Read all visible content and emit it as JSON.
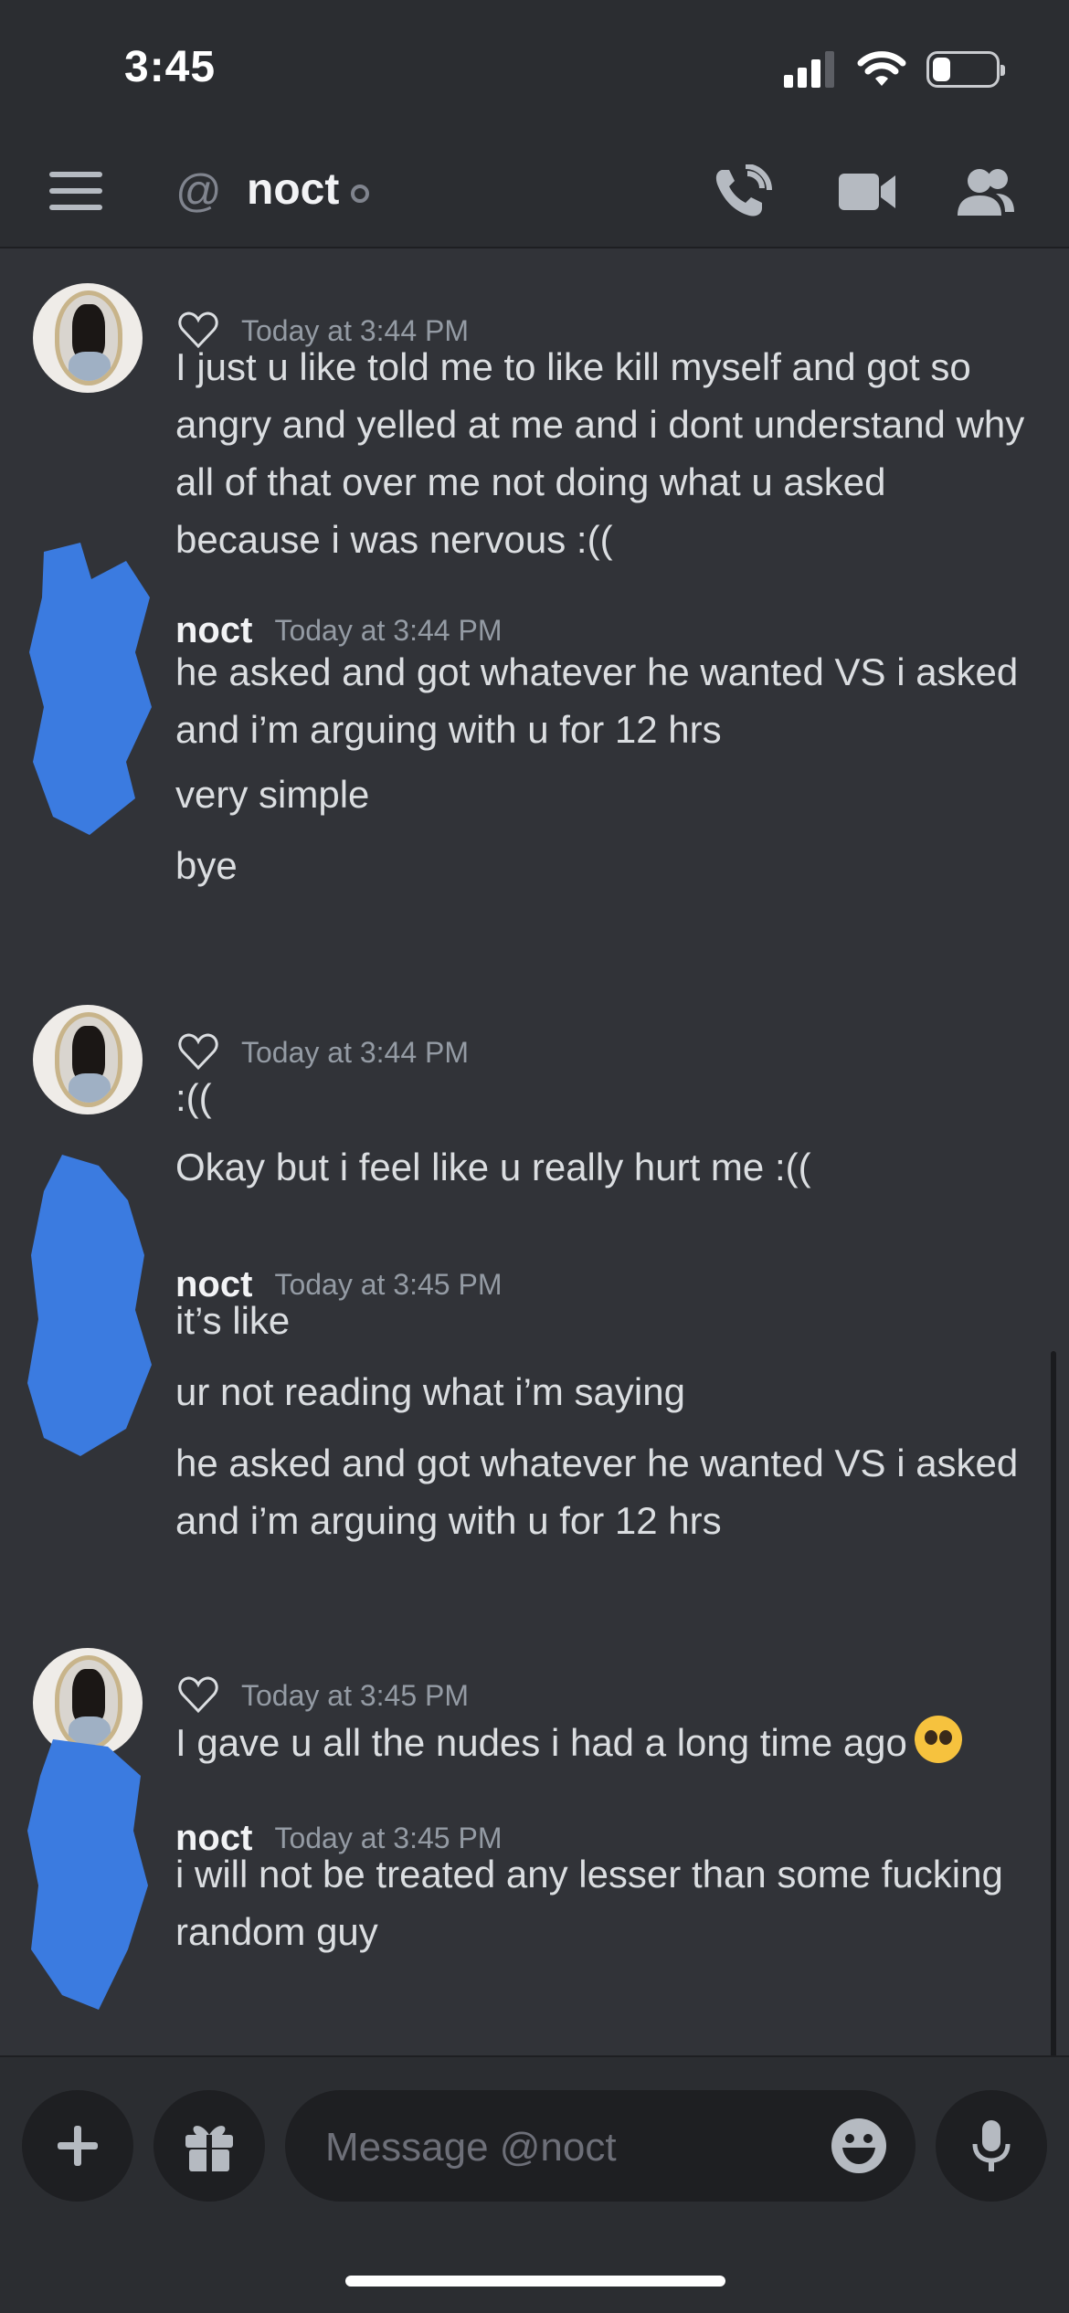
{
  "status_bar": {
    "time": "3:45",
    "battery_level": 0.25
  },
  "header": {
    "at_symbol": "@",
    "channel_name": "noct"
  },
  "messages": [
    {
      "author": "",
      "reaction_icon": "heart-outline",
      "timestamp": "Today at 3:44 PM",
      "lines": [
        "I just u like told me to like kill myself and got so angry and yelled at me and i dont understand why all of that over me not doing what u asked because i was nervous :(("
      ]
    },
    {
      "author": "noct",
      "timestamp": "Today at 3:44 PM",
      "lines": [
        "he asked and got whatever he wanted VS i asked and i’m arguing with u for 12 hrs",
        "very simple",
        "bye"
      ]
    },
    {
      "author": "",
      "reaction_icon": "heart-outline",
      "timestamp": "Today at 3:44 PM",
      "lines": [
        ":((",
        "Okay but i feel like u really hurt me :(("
      ]
    },
    {
      "author": "noct",
      "timestamp": "Today at 3:45 PM",
      "lines": [
        "it’s like",
        "ur not reading what i’m saying",
        "he asked and got whatever he wanted VS i asked and i’m arguing with u for 12 hrs"
      ]
    },
    {
      "author": "",
      "reaction_icon": "heart-outline",
      "timestamp": "Today at 3:45 PM",
      "lines": [
        "I gave u all the nudes i had a long time ago"
      ],
      "emoji": "pleading-face-emoji"
    },
    {
      "author": "noct",
      "timestamp": "Today at 3:45 PM",
      "lines": [
        "i will not be treated any lesser than some fucking random guy"
      ]
    }
  ],
  "composer": {
    "placeholder": "Message @noct"
  },
  "colors": {
    "background": "#313338",
    "topbar": "#2b2d31",
    "redaction": "#3b7be0"
  }
}
